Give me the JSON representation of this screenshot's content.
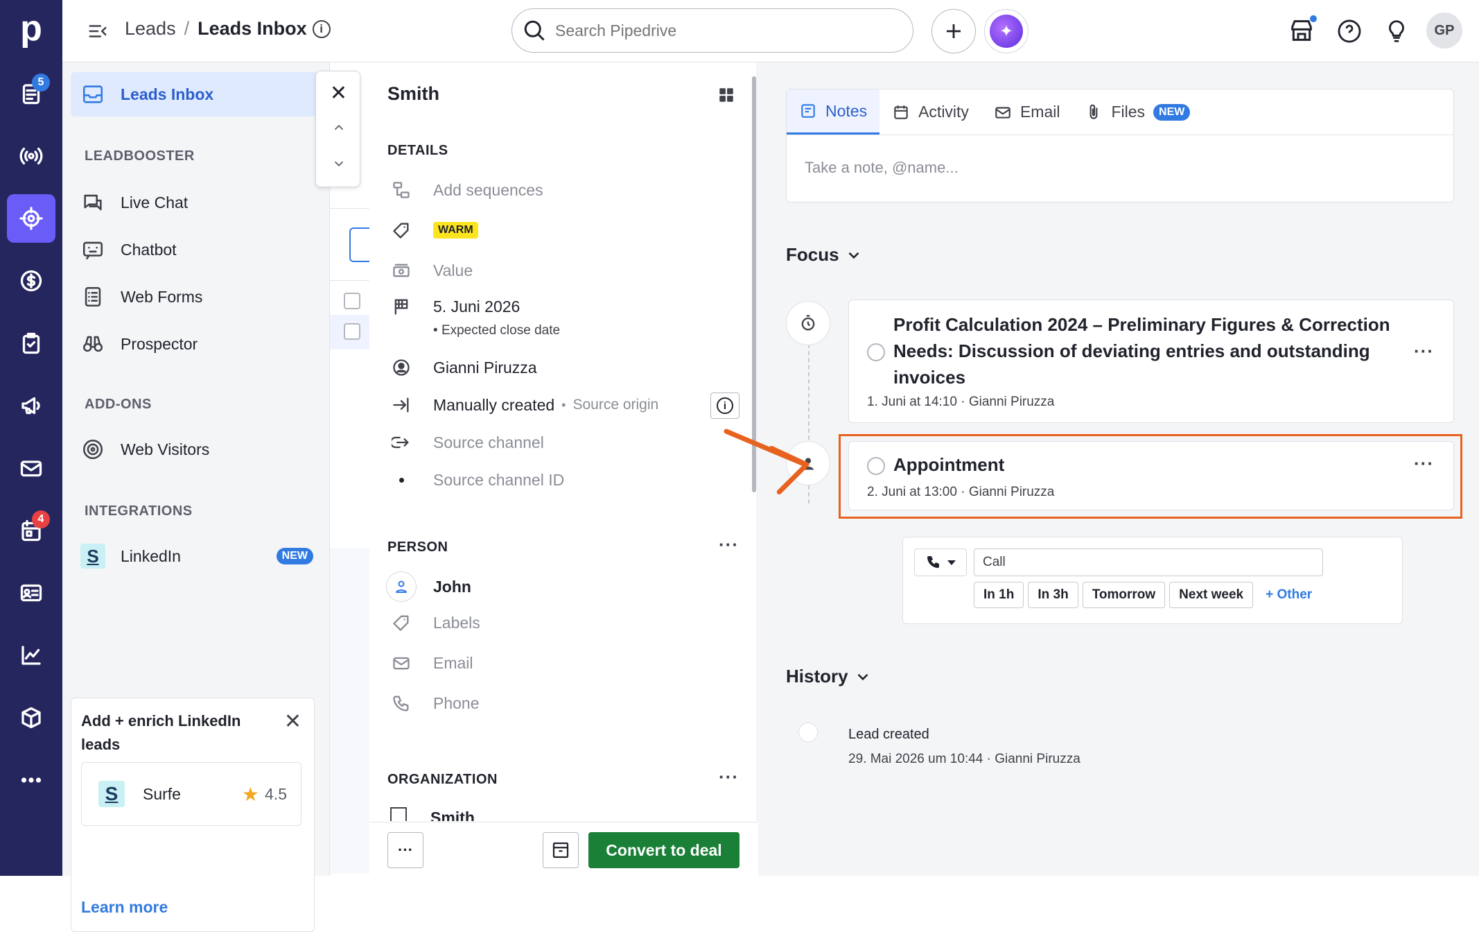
{
  "rail": {
    "logo": "p",
    "items": [
      {
        "icon": "notes-icon",
        "badge": "5"
      },
      {
        "icon": "broadcast-icon"
      },
      {
        "icon": "target-icon",
        "active": true
      },
      {
        "icon": "dollar-icon"
      },
      {
        "icon": "clipboard-icon"
      },
      {
        "icon": "megaphone-icon"
      },
      {
        "icon": "mail-icon"
      },
      {
        "icon": "calendar-icon",
        "badge": "4"
      },
      {
        "icon": "contact-card-icon"
      },
      {
        "icon": "chart-icon"
      },
      {
        "icon": "box-icon"
      },
      {
        "icon": "more-icon"
      }
    ],
    "badge_color": "#e84141",
    "badge_color_blue": "#317ae2",
    "active_color": "#6a5cf6"
  },
  "topbar": {
    "breadcrumb_root": "Leads",
    "breadcrumb_sep": "/",
    "breadcrumb_current": "Leads Inbox",
    "search_placeholder": "Search Pipedrive",
    "avatar_initials": "GP"
  },
  "sidebar": {
    "active_item": "Leads Inbox",
    "sections": [
      {
        "heading": "LEADBOOSTER",
        "items": [
          "Live Chat",
          "Chatbot",
          "Web Forms",
          "Prospector"
        ]
      },
      {
        "heading": "ADD-ONS",
        "items": [
          "Web Visitors"
        ]
      },
      {
        "heading": "INTEGRATIONS",
        "items": [
          "LinkedIn"
        ]
      }
    ],
    "linkedin_badge": "NEW",
    "promo": {
      "title": "Add + enrich LinkedIn leads",
      "app_name": "Surfe",
      "rating": "4.5",
      "link": "Learn more"
    }
  },
  "detail": {
    "title": "Smith",
    "details_heading": "DETAILS",
    "add_sequences": "Add sequences",
    "label_badge": "WARM",
    "value_placeholder": "Value",
    "close_date": "5. Juni 2026",
    "close_date_sub": "Expected close date",
    "owner": "Gianni Piruzza",
    "source_origin_value": "Manually created",
    "source_origin_label": "Source origin",
    "source_channel": "Source channel",
    "source_channel_id": "Source channel ID",
    "person_heading": "PERSON",
    "person_name": "John",
    "labels_placeholder": "Labels",
    "email_placeholder": "Email",
    "phone_placeholder": "Phone",
    "org_heading": "ORGANIZATION",
    "org_name_partial": "Smith",
    "convert_button": "Convert to deal"
  },
  "right": {
    "tabs": [
      {
        "label": "Notes",
        "active": true
      },
      {
        "label": "Activity"
      },
      {
        "label": "Email"
      },
      {
        "label": "Files",
        "badge": "NEW"
      }
    ],
    "note_placeholder": "Take a note, @name...",
    "focus_heading": "Focus",
    "activities": [
      {
        "title": "Profit Calculation 2024 – Preliminary Figures & Correction Needs: Discussion of deviating entries and outstanding invoices",
        "meta": "1. Juni at 14:10 · Gianni Piruzza"
      },
      {
        "title": "Appointment",
        "meta": "2. Juni at 13:00 · Gianni Piruzza"
      }
    ],
    "quick_add": {
      "input_value": "Call",
      "buttons": [
        "In 1h",
        "In 3h",
        "Tomorrow",
        "Next week"
      ],
      "other": "+ Other"
    },
    "history_heading": "History",
    "history": [
      {
        "title": "Lead created",
        "meta": "29. Mai 2026 um 10:44 · Gianni Piruzza"
      }
    ],
    "highlight_color": "#e8621f"
  }
}
